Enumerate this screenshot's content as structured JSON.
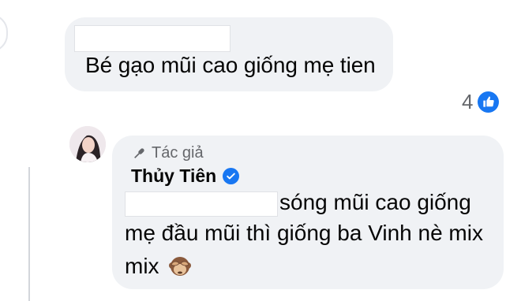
{
  "comment1": {
    "text": "Bé gạo mũi cao giống mẹ tien",
    "reaction_count": "4",
    "reaction_type": "like-icon"
  },
  "reply": {
    "author_badge": "Tác giả",
    "author_name": "Thủy Tiên",
    "lines": [
      "sóng mũi cao giống",
      "mẹ đầu mũi thì giống ba Vinh nè mix",
      "mix"
    ],
    "emoji": "see-no-evil-monkey"
  },
  "colors": {
    "bubble": "#f0f2f5",
    "accent": "#1877f2",
    "secondary_text": "#65676b"
  }
}
